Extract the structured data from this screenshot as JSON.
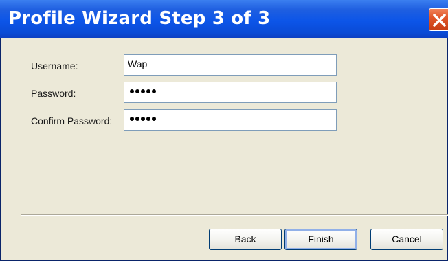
{
  "window": {
    "title": "Profile Wizard Step 3 of 3",
    "close_icon": "close-x-icon"
  },
  "form": {
    "username_label": "Username:",
    "username_value": "Wap",
    "password_label": "Password:",
    "password_mask": "•••••",
    "confirm_label": "Confirm Password:",
    "confirm_mask": "•••••"
  },
  "buttons": {
    "back": "Back",
    "finish": "Finish",
    "cancel": "Cancel"
  },
  "colors": {
    "titlebar": "#0c55e8",
    "dialog_bg": "#ece9d8",
    "close_button": "#e0562a",
    "field_border": "#7f9db9"
  }
}
